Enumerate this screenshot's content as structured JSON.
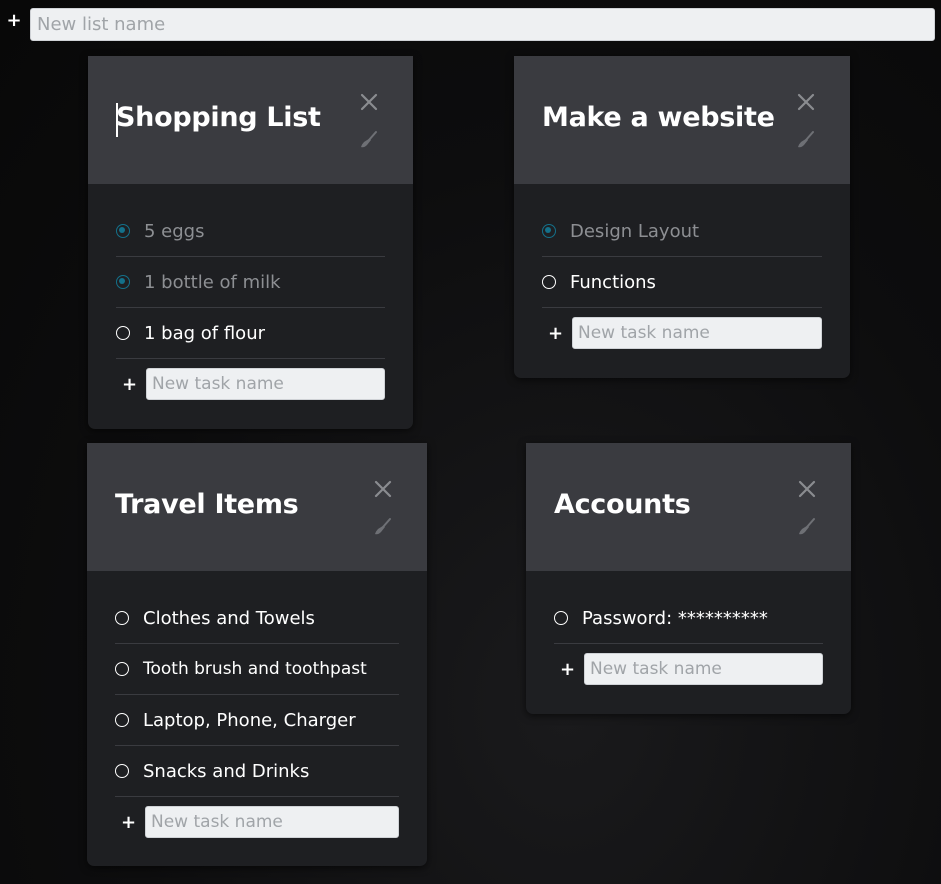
{
  "new_list": {
    "placeholder": "New list name",
    "add_icon": "plus-icon"
  },
  "colors": {
    "card_header": "#3a3b40",
    "card_body": "#1e1f22",
    "done_radio": "#14708a",
    "done_text": "#8d8f93"
  },
  "lists": [
    {
      "title": "Shopping List",
      "tasks": [
        {
          "label": "5 eggs",
          "done": true
        },
        {
          "label": "1 bottle of milk",
          "done": true
        },
        {
          "label": "1 bag of flour",
          "done": false
        }
      ],
      "new_task_placeholder": "New task name"
    },
    {
      "title": "Make a website",
      "tasks": [
        {
          "label": "Design Layout",
          "done": true
        },
        {
          "label": "Functions",
          "done": false
        }
      ],
      "new_task_placeholder": "New task name"
    },
    {
      "title": "Travel Items",
      "tasks": [
        {
          "label": "Clothes and Towels",
          "done": false
        },
        {
          "label": "Tooth brush and toothpast",
          "done": false
        },
        {
          "label": "Laptop, Phone, Charger",
          "done": false
        },
        {
          "label": "Snacks and Drinks",
          "done": false
        }
      ],
      "new_task_placeholder": "New task name"
    },
    {
      "title": "Accounts",
      "tasks": [
        {
          "label": "Password: **********",
          "done": false
        }
      ],
      "new_task_placeholder": "New task name"
    }
  ]
}
